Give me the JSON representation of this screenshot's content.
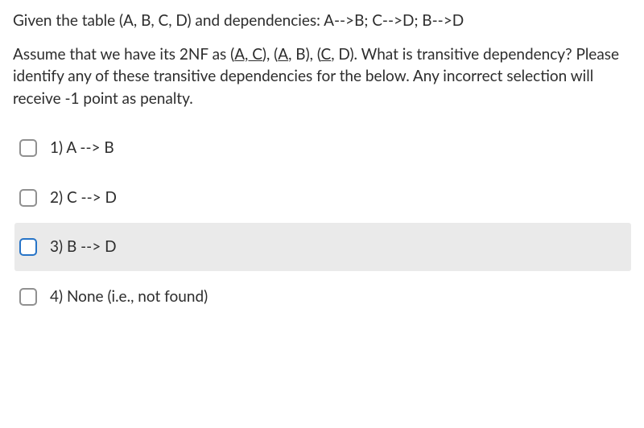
{
  "question": {
    "line1": "Given the table (A, B, C, D) and dependencies: A-->B;  C-->D; B-->D",
    "line2_pre": "Assume that we have its 2NF as (",
    "line2_u1": "A, C",
    "line2_mid1": "), (",
    "line2_u2": "A",
    "line2_mid2": ", B), (",
    "line2_u3": "C",
    "line2_mid3": ", D). What is transitive dependency? Please identify any of these transitive dependencies for the below. Any incorrect selection will receive -1 point as penalty."
  },
  "options": [
    {
      "label": "1) A --> B",
      "checked": false,
      "hover": false
    },
    {
      "label": "2) C --> D",
      "checked": false,
      "hover": false
    },
    {
      "label": "3) B --> D",
      "checked": false,
      "hover": true
    },
    {
      "label": "4) None (i.e., not found)",
      "checked": false,
      "hover": false
    }
  ]
}
